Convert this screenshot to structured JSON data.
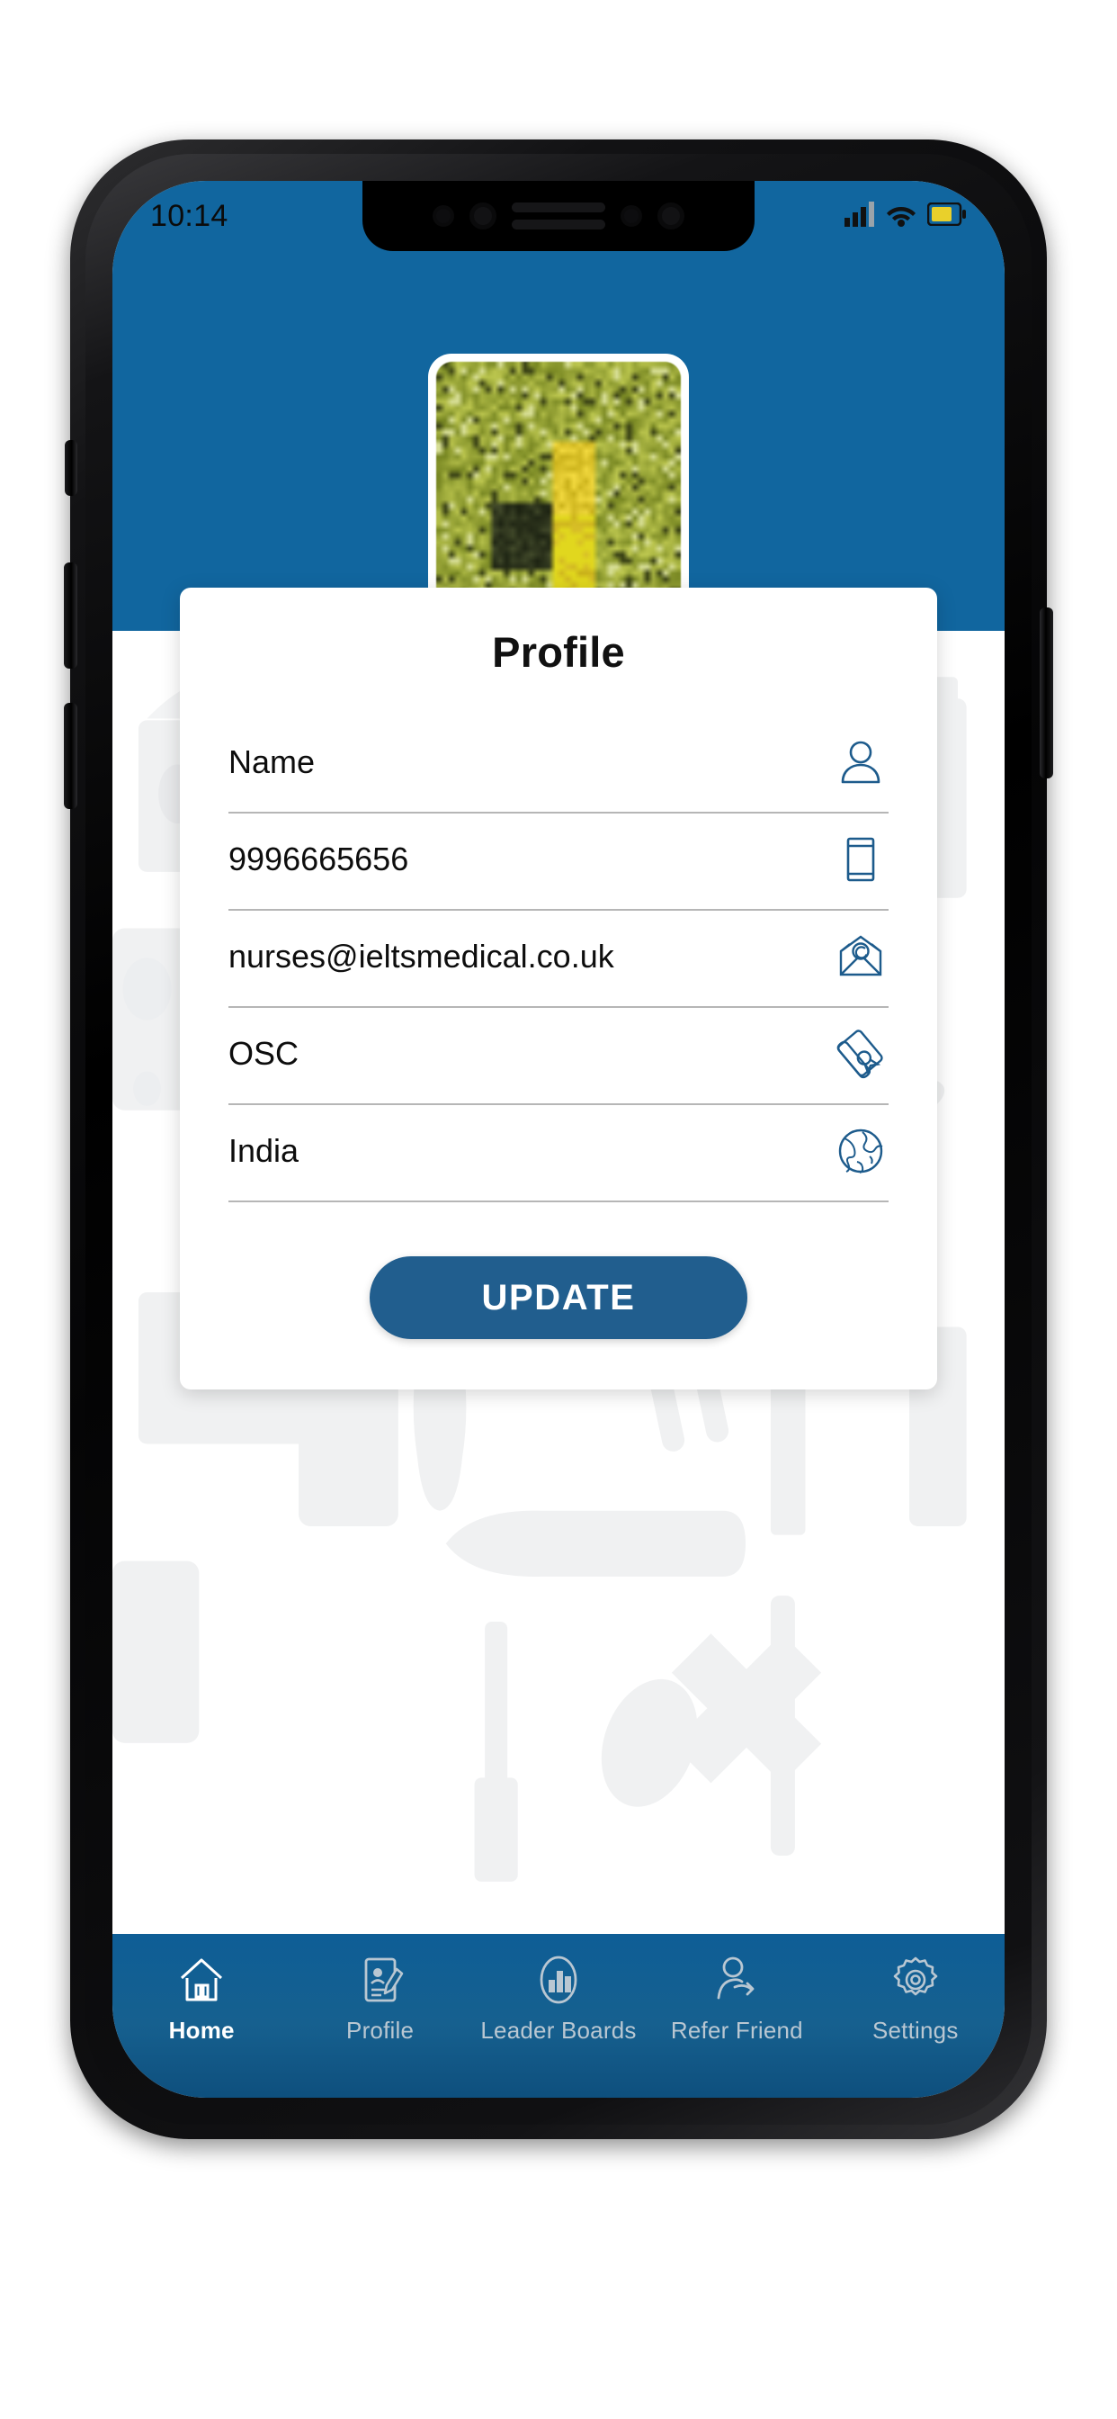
{
  "statusbar": {
    "time": "10:14",
    "signal_icon": "cellular-signal-icon",
    "wifi_icon": "wifi-icon",
    "battery_icon": "battery-icon",
    "battery_color": "#e9d02b"
  },
  "theme": {
    "brand_blue": "#11669f",
    "nav_blue": "#14608f",
    "button_blue": "#215e8e",
    "field_underline": "#b6b6b6",
    "card_bg": "#ffffff"
  },
  "avatar": {
    "name": "profile-photo",
    "alt": "User profile picture"
  },
  "card": {
    "title": "Profile",
    "fields": [
      {
        "key": "name",
        "value": "Name",
        "icon": "user-icon"
      },
      {
        "key": "phone",
        "value": "9996665656",
        "icon": "mobile-phone-icon"
      },
      {
        "key": "email",
        "value": "nurses@ieltsmedical.co.uk",
        "icon": "email-envelope-icon"
      },
      {
        "key": "course",
        "value": "OSC",
        "icon": "diploma-certificate-icon"
      },
      {
        "key": "country",
        "value": "India",
        "icon": "globe-icon"
      }
    ],
    "update_label": "UPDATE"
  },
  "bottom_nav": {
    "items": [
      {
        "label": "Home",
        "icon": "home-icon",
        "active": true
      },
      {
        "label": "Profile",
        "icon": "profile-card-icon",
        "active": false
      },
      {
        "label": "Leader Boards",
        "icon": "bar-chart-icon",
        "active": false
      },
      {
        "label": "Refer Friend",
        "icon": "refer-friend-icon",
        "active": false
      },
      {
        "label": "Settings",
        "icon": "gear-icon",
        "active": false
      }
    ]
  }
}
